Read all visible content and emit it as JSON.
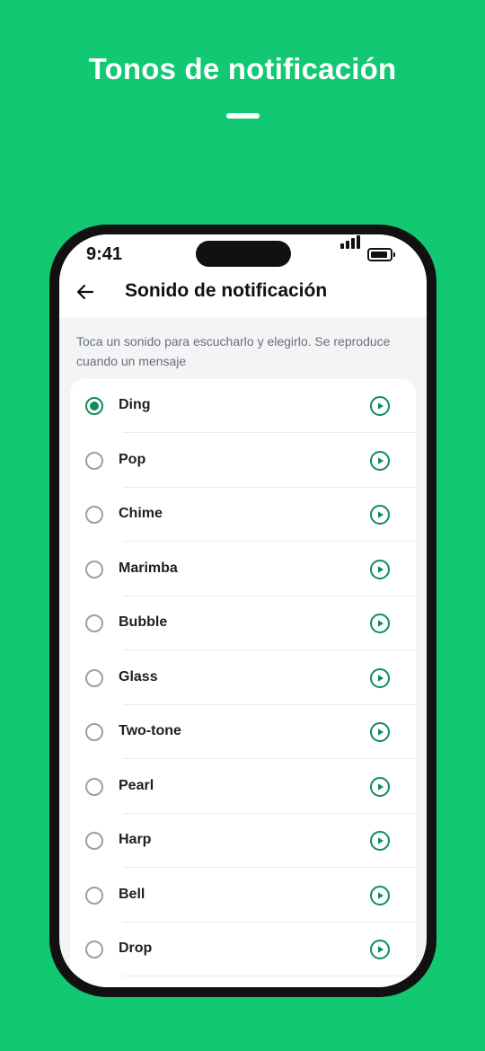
{
  "headline": "Tonos de notificación",
  "status_bar": {
    "time": "9:41"
  },
  "header": {
    "title": "Sonido de notificación"
  },
  "hint": "Toca un sonido para escucharlo y elegirlo. Se reproduce cuando un mensaje",
  "selected_index": 0,
  "sounds": [
    {
      "label": "Ding"
    },
    {
      "label": "Pop"
    },
    {
      "label": "Chime"
    },
    {
      "label": "Marimba"
    },
    {
      "label": "Bubble"
    },
    {
      "label": "Glass"
    },
    {
      "label": "Two-tone"
    },
    {
      "label": "Pearl"
    },
    {
      "label": "Harp"
    },
    {
      "label": "Bell"
    },
    {
      "label": "Drop"
    }
  ],
  "colors": {
    "background": "#13C872",
    "accent": "#0E8C58"
  },
  "icons": {
    "back": "arrow-left-icon",
    "play": "play-circle-icon"
  }
}
